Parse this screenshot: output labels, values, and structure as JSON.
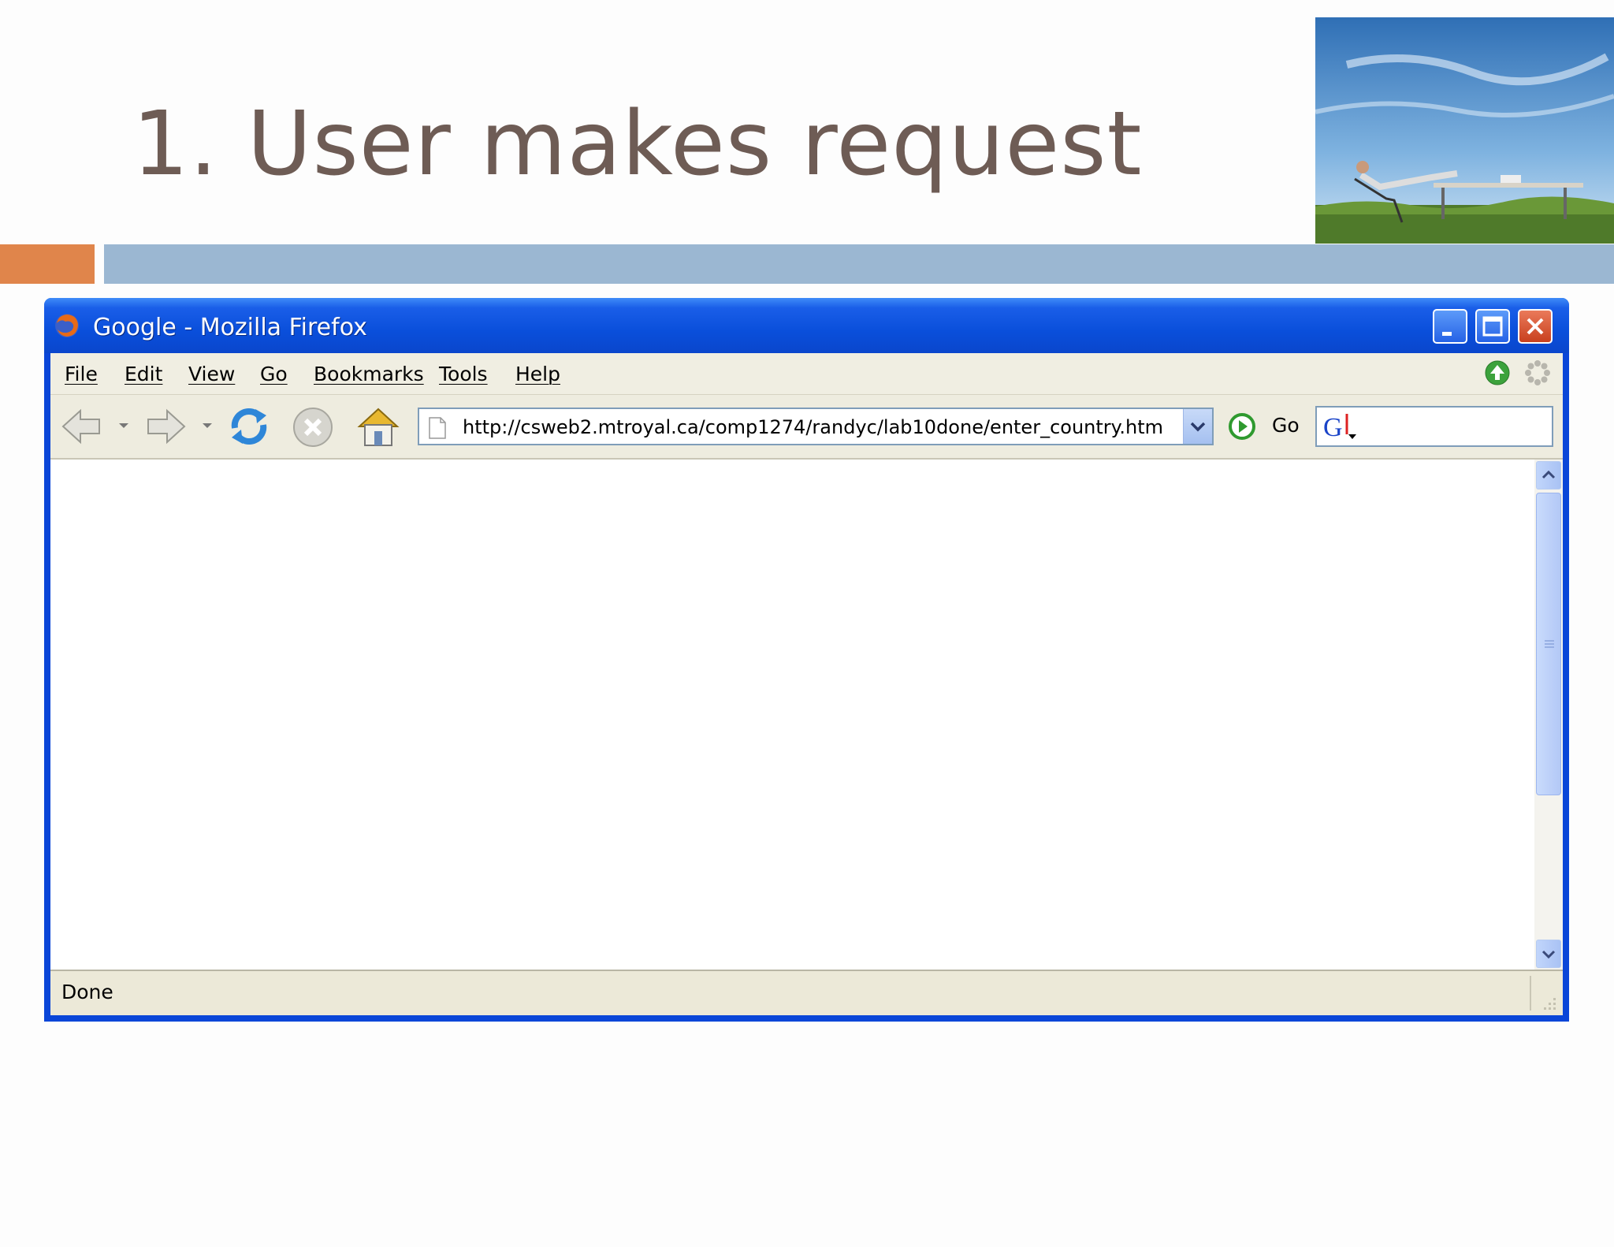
{
  "slide": {
    "title": "1. User makes request"
  },
  "window": {
    "title": "Google - Mozilla Firefox"
  },
  "menu": [
    "File",
    "Edit",
    "View",
    "Go",
    "Bookmarks",
    "Tools",
    "Help"
  ],
  "toolbar": {
    "url": "http://csweb2.mtroyal.ca/comp1274/randyc/lab10done/enter_country.htm",
    "go_label": "Go"
  },
  "status": {
    "text": "Done"
  },
  "colors": {
    "title_text": "#6e5c55",
    "accent_orange": "#e0854b",
    "accent_blue": "#9bb7d2",
    "xp_titlebar": "#0a46d8"
  },
  "icons": [
    "firefox-icon",
    "minimize-icon",
    "maximize-icon",
    "close-icon",
    "update-icon",
    "throbber-icon",
    "back-icon",
    "forward-icon",
    "reload-icon",
    "stop-icon",
    "home-icon",
    "page-icon",
    "go-icon",
    "google-search-icon"
  ]
}
